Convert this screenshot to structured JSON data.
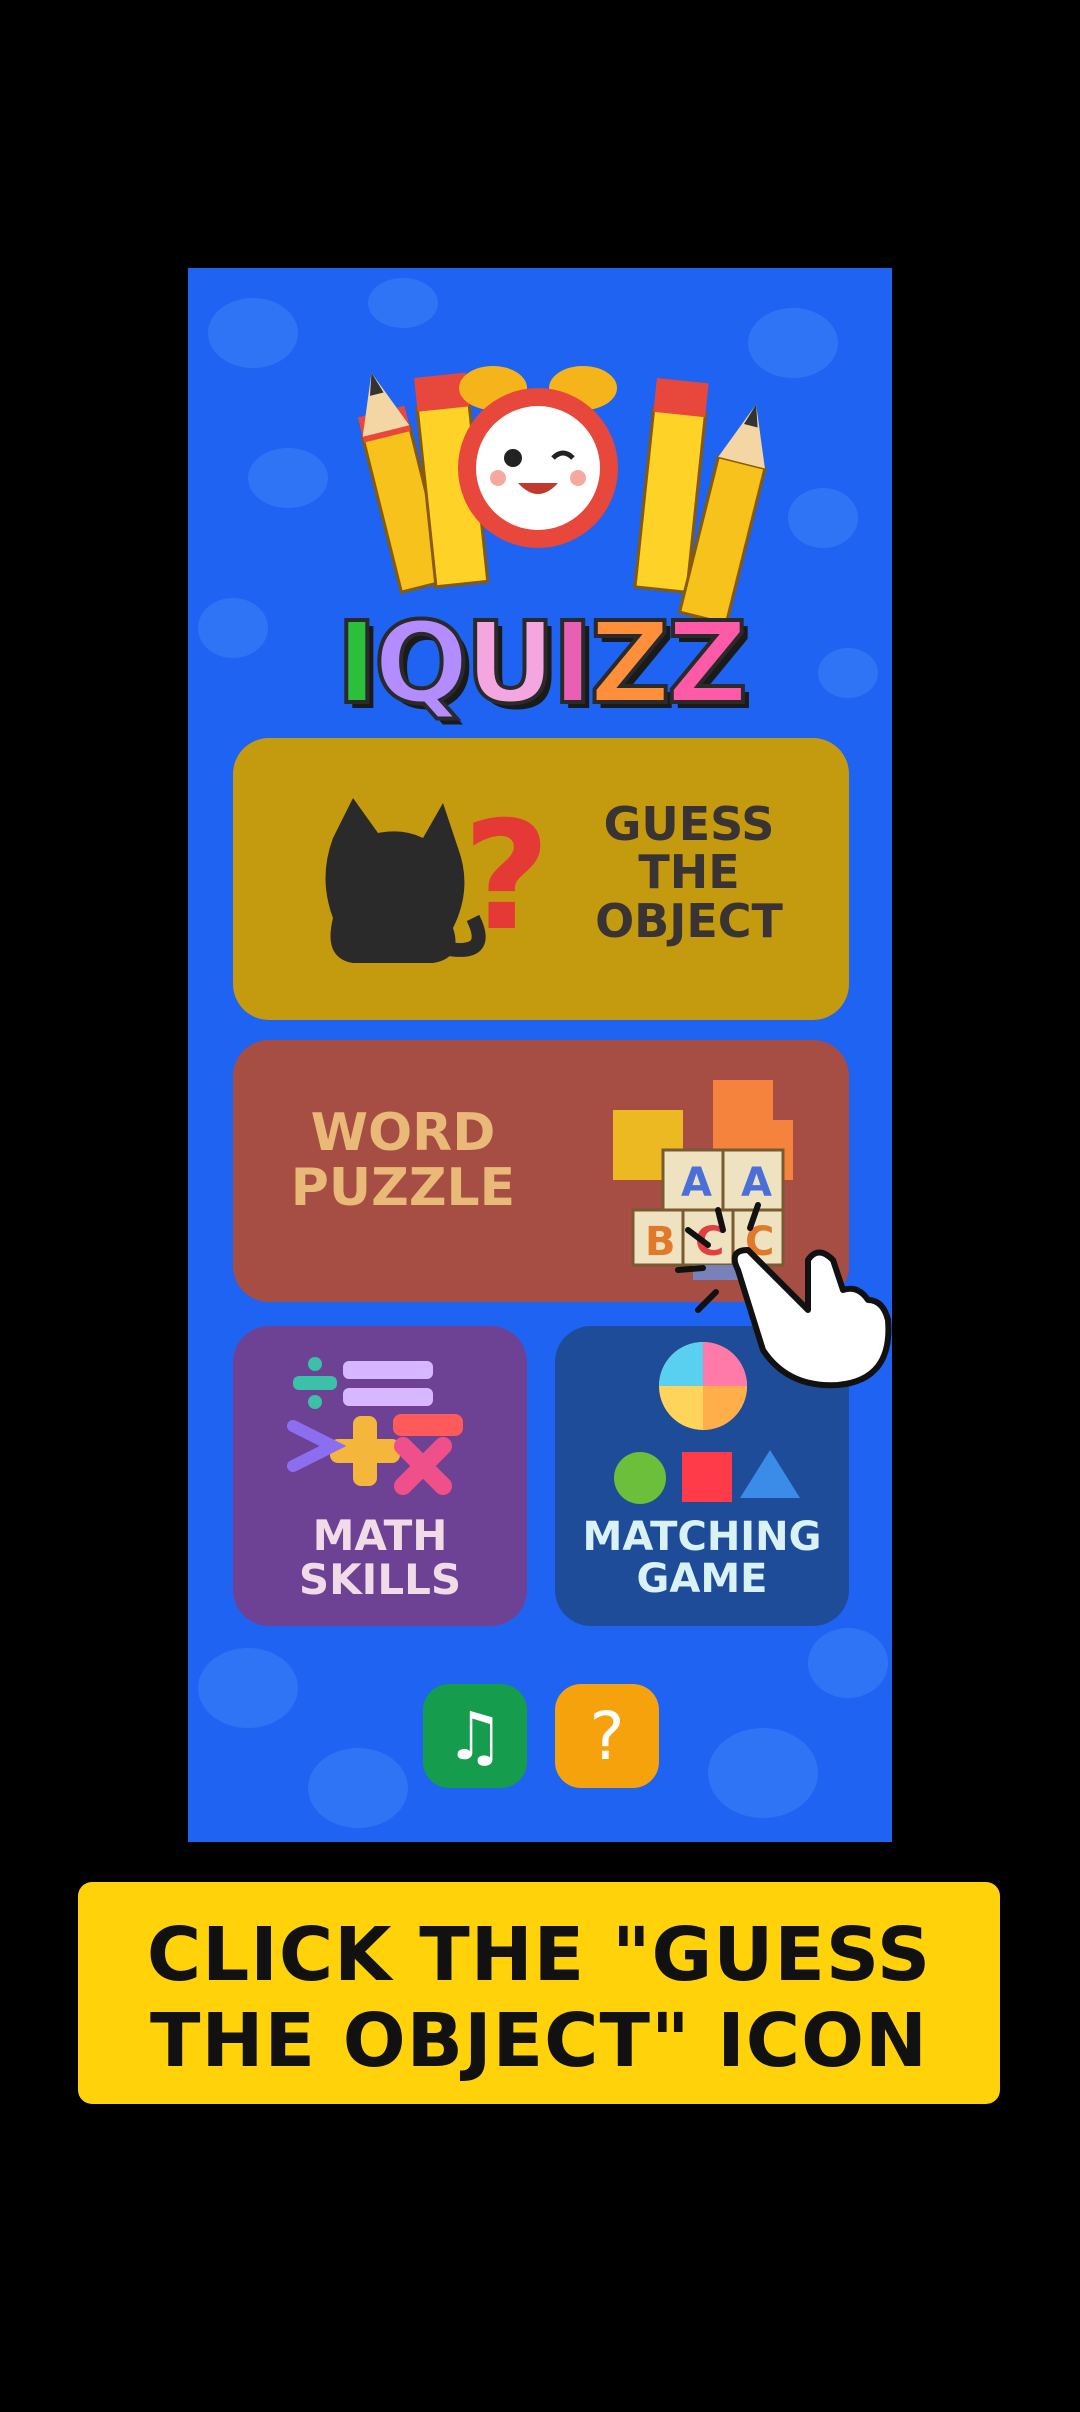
{
  "app": {
    "logo_text": [
      "I",
      "Q",
      "U",
      "I",
      "Z",
      "Z"
    ],
    "logo_colors": [
      "#2bbf3c",
      "#b38cff",
      "#f4a6e0",
      "#e85fb3",
      "#ff8f3a",
      "#ff5aa8"
    ]
  },
  "menu": {
    "guess": {
      "line1": "GUESS",
      "line2": "THE",
      "line3": "OBJECT",
      "color": "#c49a0f",
      "icon": "cat-question-icon"
    },
    "word": {
      "line1": "WORD",
      "line2": "PUZZLE",
      "color": "#a64e43",
      "icon": "alphabet-blocks-icon"
    },
    "math": {
      "line1": "MATH",
      "line2": "SKILLS",
      "color": "#6d4295",
      "icon": "math-symbols-icon"
    },
    "match": {
      "line1": "MATCHING",
      "line2": "GAME",
      "color": "#1f4c99",
      "icon": "shapes-ball-icon"
    }
  },
  "buttons": {
    "music": {
      "glyph": "♫",
      "icon": "music-note-icon",
      "color": "#159c4d"
    },
    "help": {
      "glyph": "?",
      "icon": "question-icon",
      "color": "#f5a20c"
    }
  },
  "caption": {
    "line1": "CLICK THE \"GUESS",
    "line2": "THE OBJECT\" ICON"
  }
}
